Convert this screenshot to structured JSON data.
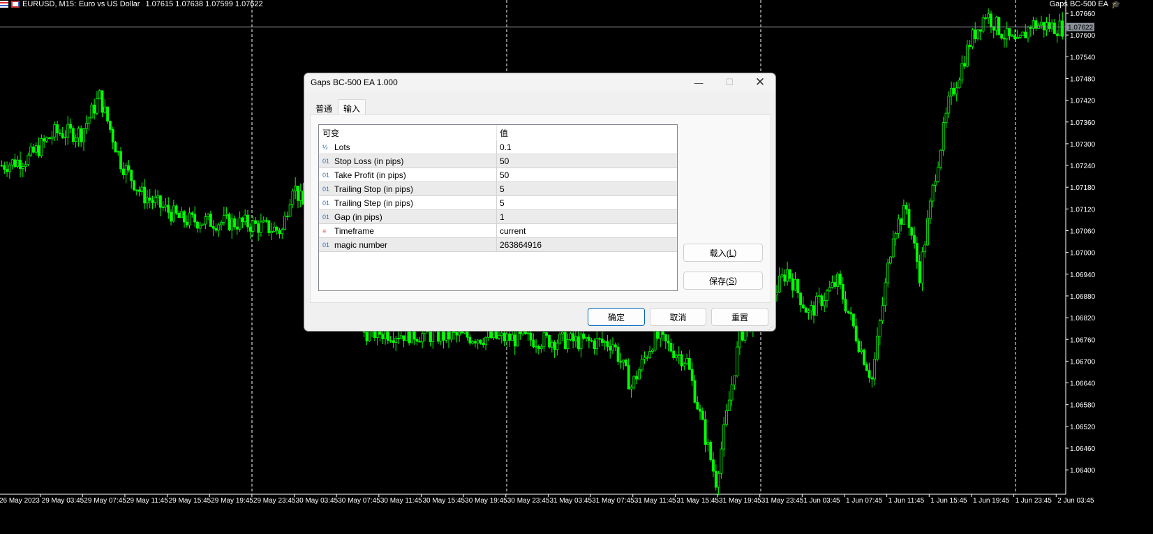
{
  "chart_header": {
    "symbol": "EURUSD, M15:",
    "description": "Euro vs US Dollar",
    "ohlc": "1.07615 1.07638 1.07599 1.07622"
  },
  "ea_label": "Gaps BC-500 EA",
  "current_price": "1.07622",
  "price_axis": [
    "1.07660",
    "1.07600",
    "1.07540",
    "1.07480",
    "1.07420",
    "1.07360",
    "1.07300",
    "1.07240",
    "1.07180",
    "1.07120",
    "1.07060",
    "1.07000",
    "1.06940",
    "1.06880",
    "1.06820",
    "1.06760",
    "1.06700",
    "1.06640",
    "1.06580",
    "1.06520",
    "1.06460",
    "1.06400"
  ],
  "time_axis": [
    "26 May 2023",
    "29 May 03:45",
    "29 May 07:45",
    "29 May 11:45",
    "29 May 15:45",
    "29 May 19:45",
    "29 May 23:45",
    "30 May 03:45",
    "30 May 07:45",
    "30 May 11:45",
    "30 May 15:45",
    "30 May 19:45",
    "30 May 23:45",
    "31 May 03:45",
    "31 May 07:45",
    "31 May 11:45",
    "31 May 15:45",
    "31 May 19:45",
    "31 May 23:45",
    "1 Jun 03:45",
    "1 Jun 07:45",
    "1 Jun 11:45",
    "1 Jun 15:45",
    "1 Jun 19:45",
    "1 Jun 23:45",
    "2 Jun 03:45"
  ],
  "price_path": [
    [
      0,
      1.0724
    ],
    [
      10,
      1.0726
    ],
    [
      20,
      1.0733
    ],
    [
      30,
      1.0733
    ],
    [
      37,
      1.0743
    ],
    [
      45,
      1.0725
    ],
    [
      53,
      1.0716
    ],
    [
      68,
      1.0709
    ],
    [
      92,
      1.0708
    ],
    [
      106,
      1.0706
    ],
    [
      110,
      1.0719
    ],
    [
      137,
      1.0678
    ],
    [
      231,
      1.0675
    ],
    [
      238,
      1.0663
    ],
    [
      247,
      1.0677
    ],
    [
      259,
      1.067
    ],
    [
      270,
      1.0637
    ],
    [
      279,
      1.0677
    ],
    [
      292,
      1.0689
    ],
    [
      297,
      1.0695
    ],
    [
      305,
      1.0683
    ],
    [
      316,
      1.0692
    ],
    [
      324,
      1.0675
    ],
    [
      329,
      1.0665
    ],
    [
      337,
      1.0706
    ],
    [
      342,
      1.0712
    ],
    [
      347,
      1.0694
    ],
    [
      353,
      1.0722
    ],
    [
      358,
      1.0741
    ],
    [
      366,
      1.0758
    ],
    [
      372,
      1.0766
    ],
    [
      379,
      1.076
    ],
    [
      384,
      1.0757
    ],
    [
      389,
      1.0763
    ],
    [
      401,
      1.0762
    ]
  ],
  "dialog": {
    "title": "Gaps BC-500 EA 1.000",
    "tabs": [
      "普通",
      "输入"
    ],
    "columns": [
      "可变",
      "值"
    ],
    "params": [
      {
        "icon": "½",
        "name": "Lots",
        "value": "0.1"
      },
      {
        "icon": "01",
        "name": "Stop Loss (in pips)",
        "value": "50"
      },
      {
        "icon": "01",
        "name": "Take Profit (in pips)",
        "value": "50"
      },
      {
        "icon": "01",
        "name": "Trailing Stop (in pips)",
        "value": "5"
      },
      {
        "icon": "01",
        "name": "Trailing Step (in pips)",
        "value": "5"
      },
      {
        "icon": "01",
        "name": "Gap (in pips)",
        "value": "1"
      },
      {
        "icon": "≡",
        "name": "Timeframe",
        "value": "current"
      },
      {
        "icon": "01",
        "name": "magic number",
        "value": "263864916"
      }
    ],
    "load_label": "载入(",
    "load_key": "L",
    "save_label": "保存(",
    "save_key": "S",
    "ok": "确定",
    "cancel": "取消",
    "reset": "重置"
  },
  "colors": {
    "candle": "#00ff00",
    "bg": "#000000",
    "accent": "#0067c0"
  }
}
